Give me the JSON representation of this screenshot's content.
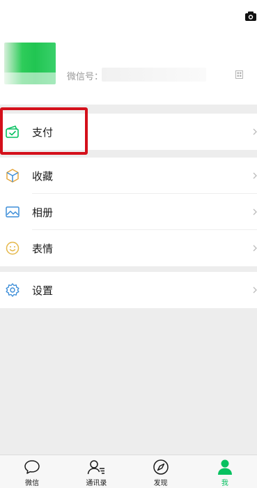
{
  "profile": {
    "wechat_id_label": "微信号："
  },
  "menu": {
    "pay": {
      "label": "支付",
      "icon": "wallet-icon"
    },
    "favorites": {
      "label": "收藏",
      "icon": "cube-icon"
    },
    "album": {
      "label": "相册",
      "icon": "image-icon"
    },
    "stickers": {
      "label": "表情",
      "icon": "smiley-icon"
    },
    "settings": {
      "label": "设置",
      "icon": "gear-icon"
    }
  },
  "tabbar": {
    "tabs": [
      {
        "label": "微信",
        "icon": "chat-bubble-icon",
        "active": false
      },
      {
        "label": "通讯录",
        "icon": "contacts-icon",
        "active": false
      },
      {
        "label": "发现",
        "icon": "compass-icon",
        "active": false
      },
      {
        "label": "我",
        "icon": "person-icon",
        "active": true
      }
    ]
  },
  "colors": {
    "accent": "#07c160",
    "highlight_box": "#d4101b",
    "background": "#ededed"
  }
}
